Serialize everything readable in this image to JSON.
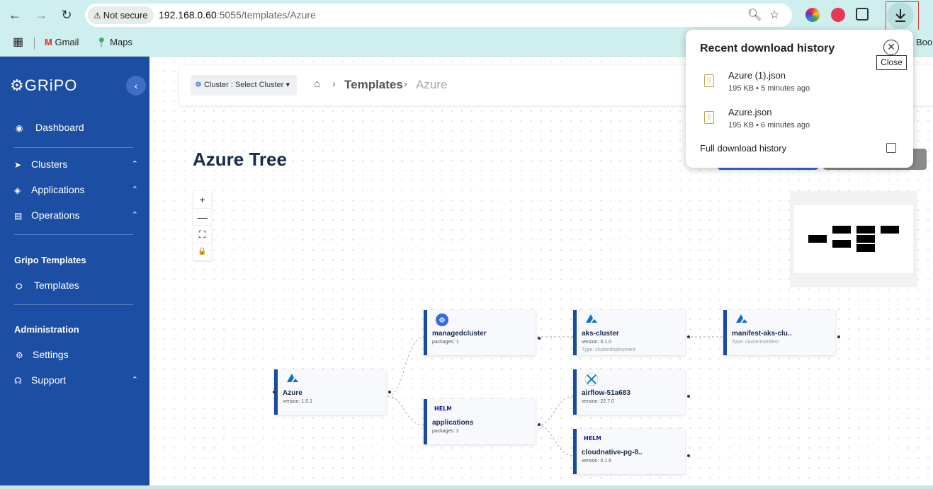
{
  "browser": {
    "security_chip": "Not secure",
    "url_host": "192.168.0.60",
    "url_rest": ":5055/templates/Azure",
    "bookmarks": [
      {
        "label": "Gmail"
      },
      {
        "label": "Maps"
      },
      {
        "label": "Book"
      }
    ]
  },
  "sidebar": {
    "logo": "GRiPO",
    "items": [
      {
        "label": "Dashboard",
        "icon": "palette-icon"
      },
      {
        "label": "Clusters",
        "icon": "send-icon"
      },
      {
        "label": "Applications",
        "icon": "layers-icon"
      },
      {
        "label": "Operations",
        "icon": "doc-icon"
      }
    ],
    "section_templates": "Gripo Templates",
    "templates_item": "Templates",
    "section_admin": "Administration",
    "settings_item": "Settings",
    "support_item": "Support"
  },
  "header": {
    "cluster_select": "Cluster : Select Cluster",
    "crumb_templates": "Templates",
    "crumb_current": "Azure"
  },
  "page": {
    "title": "Azure Tree"
  },
  "zoom": {
    "plus": "+",
    "minus": "—",
    "fit": "⛶",
    "lock": "🔒"
  },
  "nodes": {
    "azure": {
      "icon_label": "Azure",
      "title": "Azure",
      "sub": "version: 1.0.1"
    },
    "managedcluster": {
      "title": "managedcluster",
      "sub": "packages: 1"
    },
    "applications": {
      "icon_label": "HELM",
      "title": "applications",
      "sub": "packages: 2"
    },
    "aks_cluster": {
      "icon_label": "Azure",
      "title": "aks-cluster",
      "sub": "version: 0.1.0",
      "sub2": "Type: clusterdeployment"
    },
    "manifest": {
      "icon_label": "Azure",
      "title": "manifest-aks-clu..",
      "sub2": "Type: clustermanifest"
    },
    "airflow": {
      "title": "airflow-51a683",
      "sub": "version: 22.7.0"
    },
    "cloudnative": {
      "icon_label": "HELM",
      "title": "cloudnative-pg-8..",
      "sub": "version: 0.1.6"
    }
  },
  "downloads": {
    "title": "Recent download history",
    "items": [
      {
        "name": "Azure (1).json",
        "meta": "195 KB • 5 minutes ago"
      },
      {
        "name": "Azure.json",
        "meta": "195 KB • 6 minutes ago"
      }
    ],
    "full_history": "Full download history",
    "close_tooltip": "Close"
  }
}
